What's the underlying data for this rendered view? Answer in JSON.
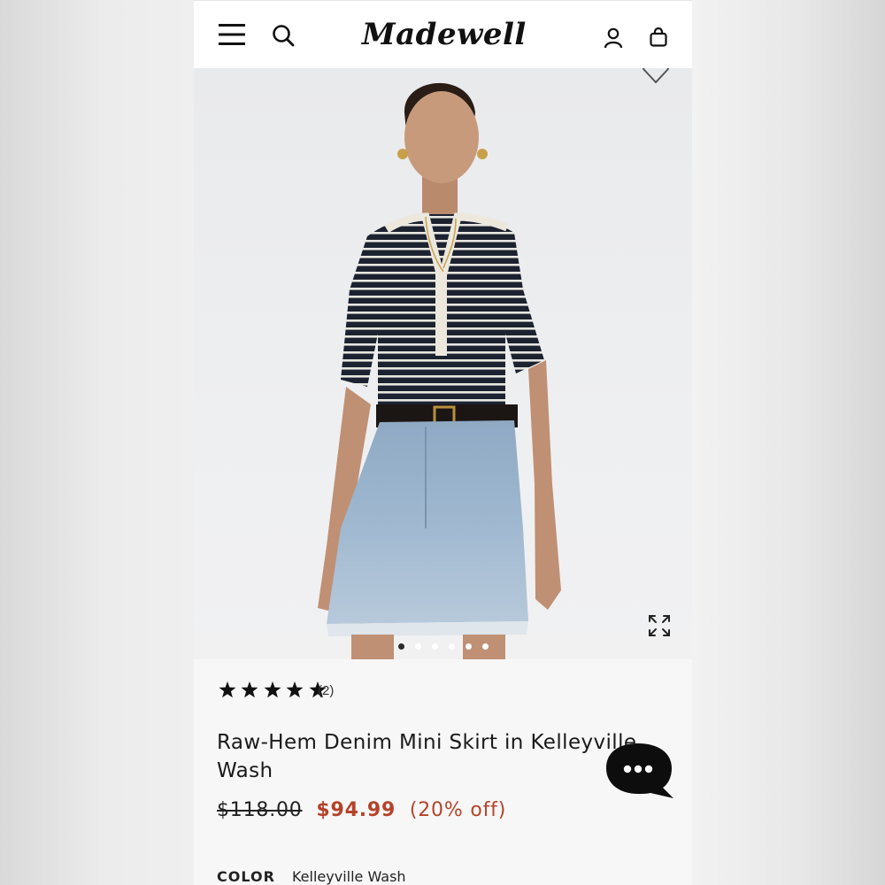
{
  "header": {
    "logo_text": "Madewell",
    "icons": [
      "menu-icon",
      "search-icon",
      "account-icon",
      "bag-icon"
    ]
  },
  "hero": {
    "image_description": "",
    "slide_count": 6,
    "active_slide": 1,
    "icons": [
      "wishlist-heart-icon",
      "expand-icon"
    ]
  },
  "product": {
    "rating": 5,
    "reviews_label": "(2)",
    "title": "Raw-Hem Denim Mini Skirt in Kelleyville Wash",
    "original_price": "$118.00",
    "sale_price": "$94.99",
    "discount": "(20% off)",
    "color_label": "COLOR",
    "color_value": "Kelleyville Wash"
  },
  "chat": {
    "icon": "chat-bubble-icon"
  },
  "colors": {
    "sale": "#b5432a",
    "text": "#1a1a1a",
    "page_bg": "#f7f7f7"
  }
}
